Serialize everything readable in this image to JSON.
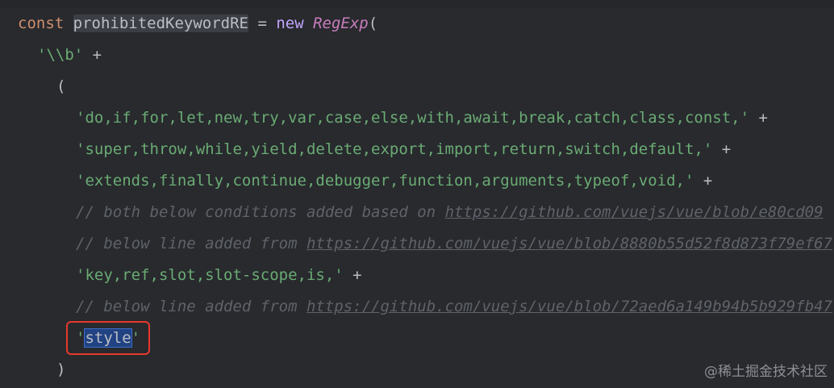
{
  "editor": {
    "theme_colors": {
      "background": "#282a2e",
      "keyword": "#cf8e6d",
      "string": "#6aab73",
      "comment": "#5f6269",
      "highlight_box": "#e8382d"
    },
    "lines": {
      "l1": {
        "kw_const": "const",
        "ident": "prohibitedKeywordRE",
        "op_eq": " = ",
        "kw_new": "new",
        "cls": "RegExp",
        "paren": "("
      },
      "l2": {
        "str": "'\\\\b'",
        "op": " +"
      },
      "l3": {
        "paren": "("
      },
      "l4": {
        "str": "'do,if,for,let,new,try,var,case,else,with,await,break,catch,class,const,'",
        "op": " +"
      },
      "l5": {
        "str": "'super,throw,while,yield,delete,export,import,return,switch,default,'",
        "op": " +"
      },
      "l6": {
        "str": "'extends,finally,continue,debugger,function,arguments,typeof,void,'",
        "op": " +"
      },
      "l7": {
        "cmt": "// both below conditions added based on ",
        "url": "https://github.com/vuejs/vue/blob/e80cd09"
      },
      "l8": {
        "cmt": "// below line added from ",
        "url": "https://github.com/vuejs/vue/blob/8880b55d52f8d873f79ef67"
      },
      "l9": {
        "str": "'key,ref,slot,slot-scope,is,'",
        "op": " +"
      },
      "l10": {
        "cmt": "// below line added from ",
        "url": "https://github.com/vuejs/vue/blob/72aed6a149b94b5b929fb47"
      },
      "l11": {
        "quote_open": "'",
        "word": "style",
        "quote_close": "'"
      },
      "l12": {
        "paren": ")"
      }
    }
  },
  "watermark": "@稀土掘金技术社区"
}
